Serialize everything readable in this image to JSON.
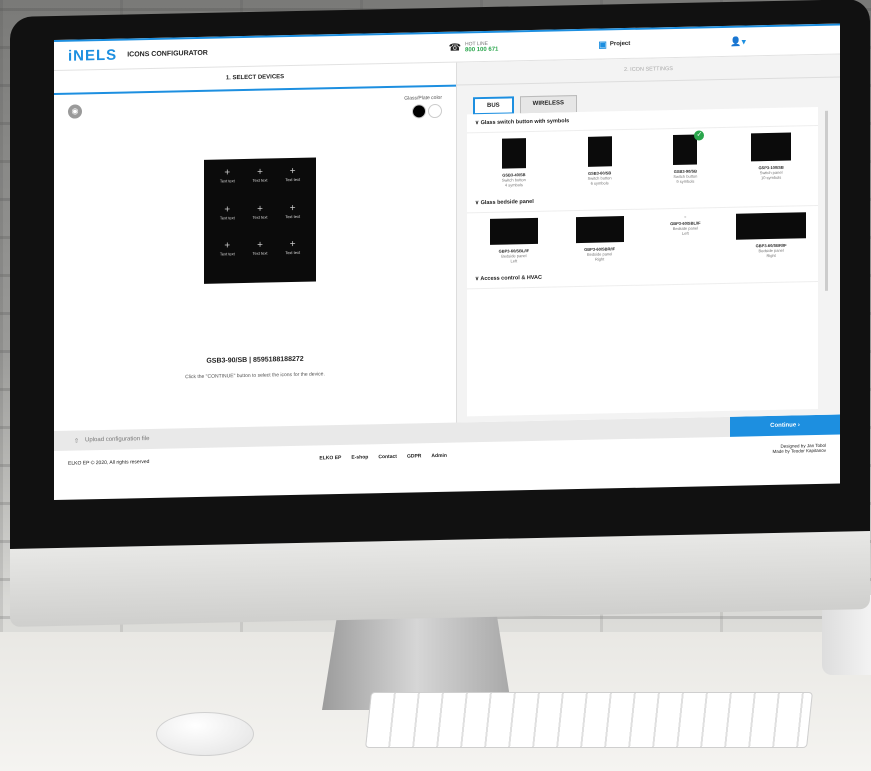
{
  "header": {
    "logo": "iNELS",
    "title": "ICONS CONFIGURATOR",
    "hotline_label": "HOT LINE",
    "hotline_number": "800 100 671",
    "project": "Project"
  },
  "steps": {
    "step1": "1. SELECT DEVICES",
    "step2": "2. ICON SETTINGS"
  },
  "left": {
    "glass_label": "Glass/Plate color",
    "device_title": "GSB3-90/SB | 8595188188272",
    "hint": "Click the \"CONTINUE\" button to select the icons for the device.",
    "cell_text": "Text text",
    "colors": [
      "#000000",
      "#ffffff"
    ]
  },
  "tabs": {
    "bus": "BUS",
    "wireless": "WIRELESS"
  },
  "sections": {
    "switch": {
      "title": "Glass switch button with symbols",
      "items": [
        {
          "name": "GSB3-40/SB",
          "l1": "Switch button",
          "l2": "4 symbols"
        },
        {
          "name": "GSB3-60/SB",
          "l1": "Switch button",
          "l2": "6 symbols"
        },
        {
          "name": "GSB3-90/SB",
          "l1": "Switch button",
          "l2": "9 symbols"
        },
        {
          "name": "GSP3-100/SB",
          "l1": "Switch panel",
          "l2": "10 symbols"
        }
      ]
    },
    "bedside": {
      "title": "Glass bedside panel",
      "items": [
        {
          "name": "GBP3-60/SBL/IF",
          "l1": "Bedside panel",
          "l2": "Left"
        },
        {
          "name": "GBP3-60/SBR/IF",
          "l1": "Bedside panel",
          "l2": "Right"
        },
        {
          "name": "GBP3-60/SBL/IF",
          "l1": "Bedside panel",
          "l2": "Left"
        },
        {
          "name": "GBP3-60/SBR/IF",
          "l1": "Bedside panel",
          "l2": "Right"
        }
      ]
    },
    "access": {
      "title": "Access control & HVAC"
    }
  },
  "bottom": {
    "upload": "Upload configuration file",
    "continue": "Continue"
  },
  "footer": {
    "copyright": "ELKO EP © 2020, All rights reserved",
    "links": [
      "ELKO EP",
      "E-shop",
      "Contact",
      "GDPR",
      "Admin"
    ],
    "designed": "Designed by Jan Tobol",
    "made": "Made by Teodor Kapitanov"
  },
  "colors": {
    "accent": "#1d8fe0",
    "success": "#2aa64c"
  }
}
